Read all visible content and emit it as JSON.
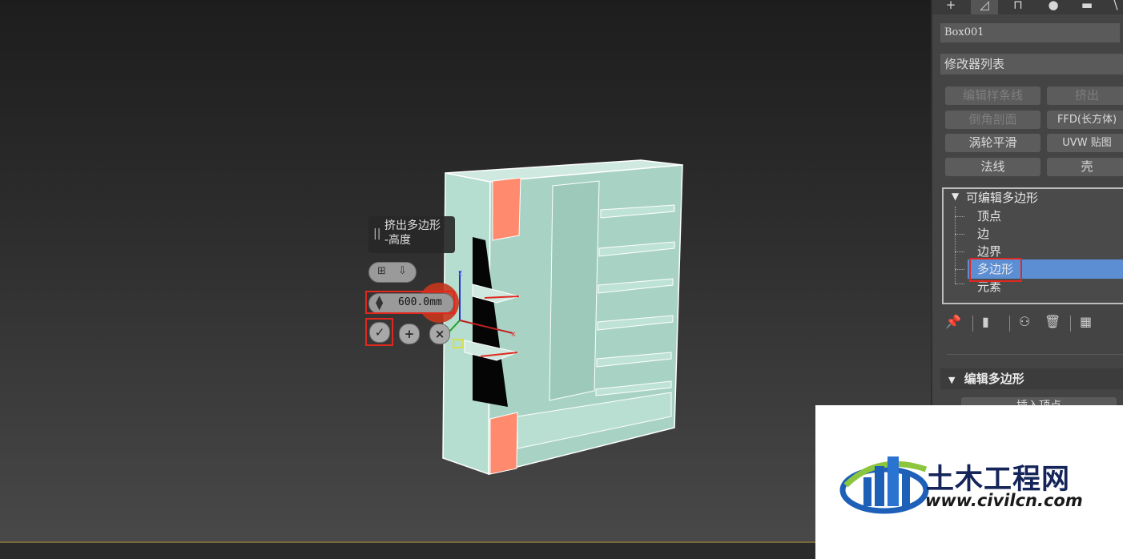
{
  "caddy": {
    "title_line1": "挤出多边形",
    "title_line2": "-高度",
    "height_value": "600.0mm"
  },
  "panel": {
    "object_name": "Box001",
    "modifier_list": "修改器列表",
    "buttons": [
      "编辑样条线",
      "挤出",
      "倒角剖面",
      "FFD(长方体)",
      "涡轮平滑",
      "UVW 贴图",
      "法线",
      "壳"
    ],
    "stack": {
      "root": "可编辑多边形",
      "items": [
        "顶点",
        "边",
        "边界",
        "多边形",
        "元素"
      ],
      "selected": "多边形"
    },
    "rollout_title": "编辑多边形",
    "rollout_button": "插入顶点"
  },
  "watermark": {
    "cn_text": "土木工程网",
    "url": "www.civilcn.com"
  },
  "colors": {
    "selection_blue": "#5c8ed4",
    "highlight_red": "#e0281e",
    "selected_face": "#ff8a6e",
    "model_face": "#a8d3c4"
  }
}
